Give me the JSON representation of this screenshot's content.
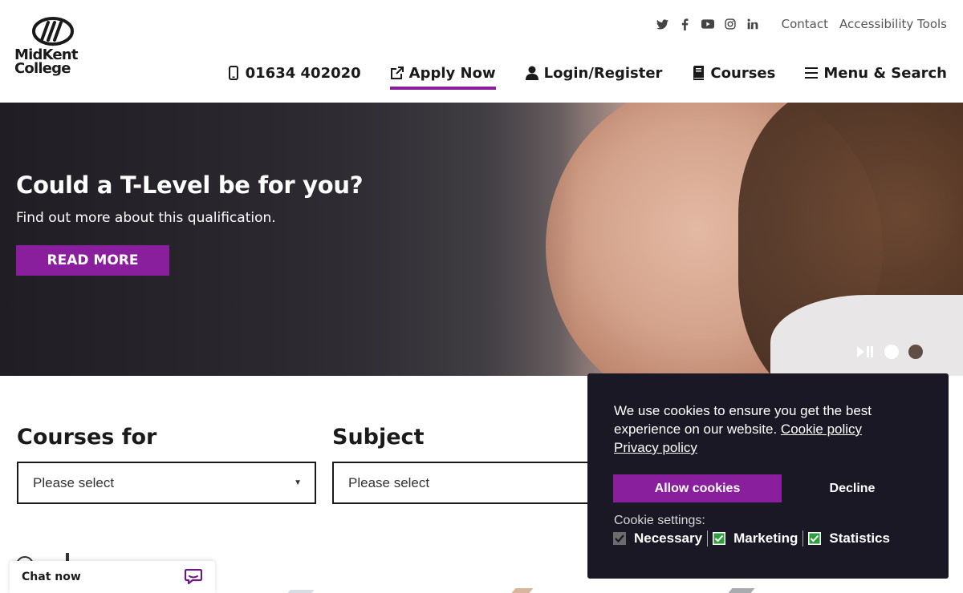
{
  "header": {
    "logo": {
      "line1": "MidKent",
      "line2": "College"
    },
    "utility": {
      "social_icons": [
        "twitter-icon",
        "facebook-icon",
        "youtube-icon",
        "instagram-icon",
        "linkedin-icon"
      ],
      "contact_label": "Contact",
      "accessibility_label": "Accessibility Tools"
    },
    "nav": {
      "phone": "01634 402020",
      "apply": "Apply Now",
      "login": "Login/Register",
      "courses": "Courses",
      "menu": "Menu & Search"
    },
    "accent_color": "#8a1f9e"
  },
  "hero": {
    "title": "Could a T-Level be for you?",
    "subtitle": "Find out more about this qualification.",
    "button": "READ MORE",
    "slides_total": 2,
    "active_slide": 1
  },
  "search": {
    "courses_for_label": "Courses for",
    "courses_for_value": "Please select",
    "subject_label": "Subject",
    "subject_value": "Please select"
  },
  "chat": {
    "label": "Chat now"
  },
  "cookie": {
    "message": "We use cookies to ensure you get the best experience on our website.",
    "cookie_policy_link": "Cookie policy",
    "privacy_policy_link": "Privacy policy",
    "allow_button": "Allow cookies",
    "decline_button": "Decline",
    "settings_label": "Cookie settings:",
    "options": [
      {
        "label": "Necessary",
        "checked": true,
        "disabled": true
      },
      {
        "label": "Marketing",
        "checked": true,
        "disabled": false
      },
      {
        "label": "Statistics",
        "checked": true,
        "disabled": false
      }
    ],
    "background": "#1b1826"
  }
}
